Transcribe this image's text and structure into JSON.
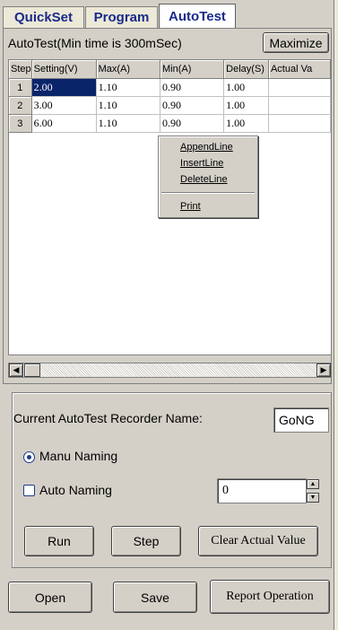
{
  "tabs": [
    "QuickSet",
    "Program",
    "AutoTest"
  ],
  "header": {
    "title": "AutoTest(Min time is 300mSec)",
    "maximize_label": "Maximize"
  },
  "grid": {
    "columns": [
      "Step",
      "Setting(V)",
      "Max(A)",
      "Min(A)",
      "Delay(S)",
      "Actual Va"
    ],
    "rows": [
      [
        "1",
        "2.00",
        "1.10",
        "0.90",
        "1.00",
        ""
      ],
      [
        "2",
        "3.00",
        "1.10",
        "0.90",
        "1.00",
        ""
      ],
      [
        "3",
        "6.00",
        "1.10",
        "0.90",
        "1.00",
        ""
      ]
    ]
  },
  "context_menu": {
    "items": [
      "AppendLine",
      "InsertLine",
      "DeleteLine",
      "Print"
    ]
  },
  "recorder": {
    "label": "Current AutoTest Recorder Name:",
    "name_value": "GoNG",
    "manu_naming_label": "Manu Naming",
    "auto_naming_label": "Auto Naming",
    "auto_naming_value": "0"
  },
  "buttons": {
    "run": "Run",
    "step": "Step",
    "clear": "Clear Actual Value",
    "open": "Open",
    "save": "Save",
    "report": "Report Operation"
  },
  "colors": {
    "selection": "#0a246a",
    "accent": "#1f3a8a",
    "face": "#d4d0c8"
  }
}
